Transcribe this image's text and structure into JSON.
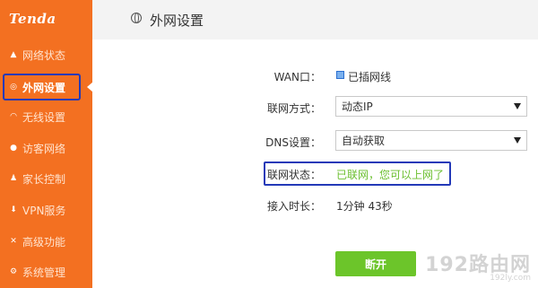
{
  "brand": {
    "logo_text": "Tenda"
  },
  "sidebar": {
    "items": [
      {
        "label": "网络状态",
        "icon": "home-icon"
      },
      {
        "label": "外网设置",
        "icon": "globe-icon",
        "active": true
      },
      {
        "label": "无线设置",
        "icon": "wifi-icon"
      },
      {
        "label": "访客网络",
        "icon": "location-pin-icon"
      },
      {
        "label": "家长控制",
        "icon": "person-icon"
      },
      {
        "label": "VPN服务",
        "icon": "download-icon"
      },
      {
        "label": "高级功能",
        "icon": "tools-icon"
      },
      {
        "label": "系统管理",
        "icon": "gear-icon"
      }
    ]
  },
  "header": {
    "title": "外网设置"
  },
  "form": {
    "wan_label": "WAN口：",
    "wan_value": "已插网线",
    "conn_mode_label": "联网方式：",
    "conn_mode_value": "动态IP",
    "dns_label": "DNS设置：",
    "dns_value": "自动获取",
    "status_label": "联网状态：",
    "status_value": "已联网，您可以上网了",
    "duration_label": "接入时长：",
    "duration_value": "1分钟 43秒",
    "disconnect_button": "断开"
  },
  "watermark": {
    "big": "192路由网",
    "small": "192ly.com"
  },
  "colors": {
    "sidebar": "#f37021",
    "highlight_border": "#2339b8",
    "status_green": "#6bbf2f",
    "button_green": "#6cc52a"
  }
}
